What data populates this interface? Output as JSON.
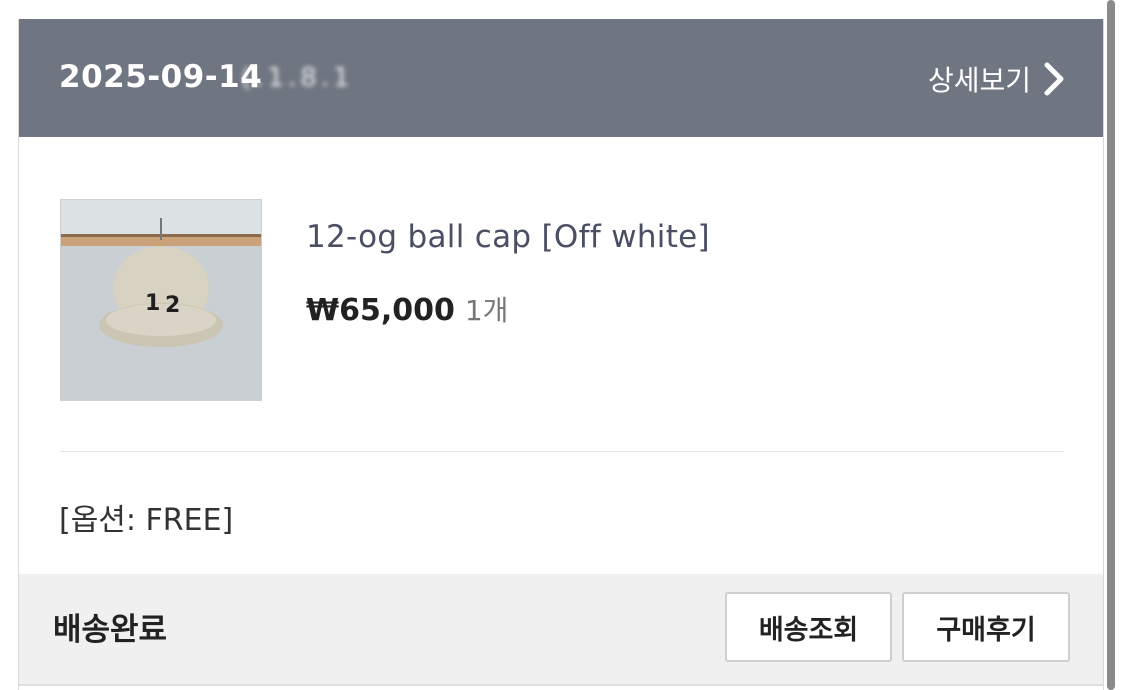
{
  "order": {
    "date": "2025-09-14",
    "order_id": "(.1.8.1",
    "detail_label": "상세보기"
  },
  "product": {
    "name": "12-og ball cap [Off white]",
    "price": "₩65,000",
    "quantity": "1개",
    "option": "[옵션: FREE]",
    "thumbnail_icon": "cap-product-image"
  },
  "footer": {
    "status": "배송완료",
    "track_button": "배송조회",
    "review_button": "구매후기"
  },
  "colors": {
    "header_bg": "#707681",
    "footer_bg": "#f0f0f0",
    "product_name": "#4a4f63"
  }
}
